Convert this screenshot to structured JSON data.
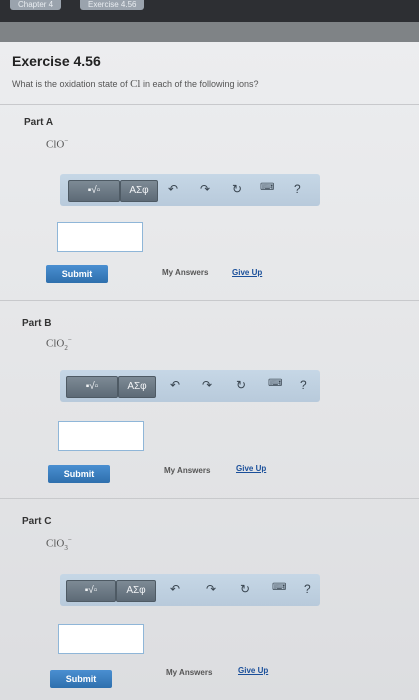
{
  "breadcrumb": {
    "chapter": "Chapter 4",
    "exercise": "Exercise 4.56"
  },
  "exercise": {
    "title": "Exercise 4.56",
    "question_prefix": "What is the oxidation state of ",
    "question_element": "Cl",
    "question_suffix": " in each of the following ions?"
  },
  "toolbar": {
    "templates_label": "▪√▫",
    "symbols_label": "ΑΣφ",
    "help_label": "?"
  },
  "parts": [
    {
      "label": "Part A",
      "formula_base": "ClO",
      "formula_sub": "",
      "formula_charge": "−"
    },
    {
      "label": "Part B",
      "formula_base": "ClO",
      "formula_sub": "2",
      "formula_charge": "−"
    },
    {
      "label": "Part C",
      "formula_base": "ClO",
      "formula_sub": "3",
      "formula_charge": "−"
    }
  ],
  "actions": {
    "submit_label": "Submit",
    "my_answers_label": "My Answers",
    "give_up_label": "Give Up"
  }
}
